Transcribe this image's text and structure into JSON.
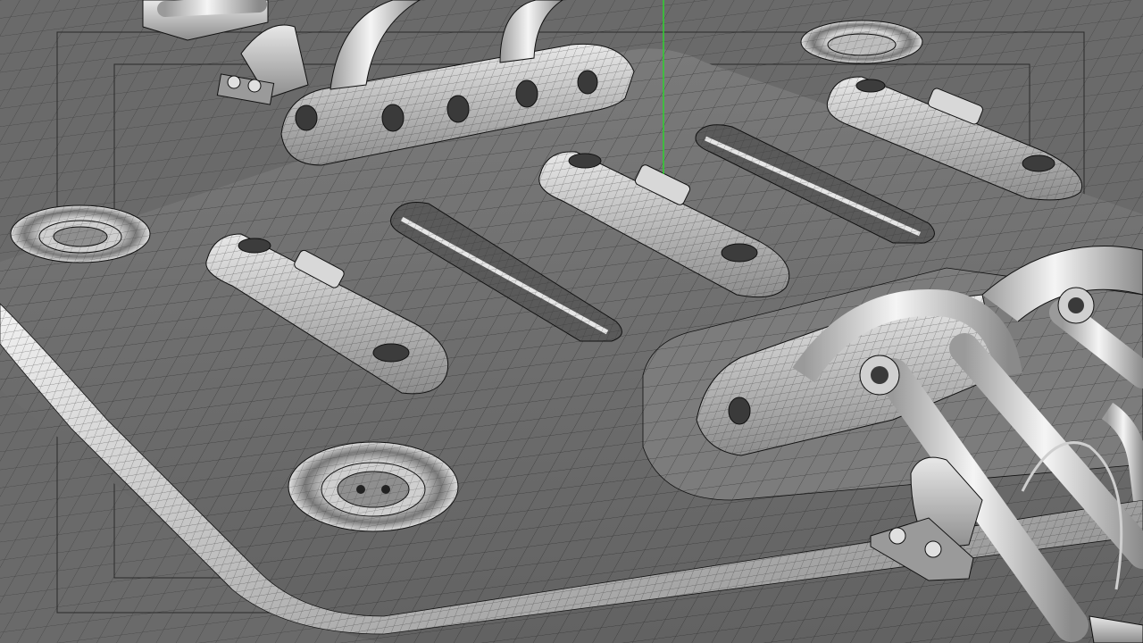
{
  "viewport": {
    "mode": "wireframe-on-shaded",
    "background_color": "#6e6e6e",
    "wire_color": "#111111",
    "highlight_color": "#ffffff",
    "axis_color": "#2fd12f"
  },
  "scene": {
    "objects": [
      {
        "name": "base-plate"
      },
      {
        "name": "raised-platform"
      },
      {
        "name": "bolt-socket-front"
      },
      {
        "name": "bolt-socket-left"
      },
      {
        "name": "bolt-socket-top"
      },
      {
        "name": "slot-cutout-left"
      },
      {
        "name": "slot-cutout-right"
      },
      {
        "name": "clamp-block-left"
      },
      {
        "name": "clamp-block-center"
      },
      {
        "name": "clamp-block-right"
      },
      {
        "name": "pipe-mount-top"
      },
      {
        "name": "pipe-mount-right"
      }
    ]
  }
}
